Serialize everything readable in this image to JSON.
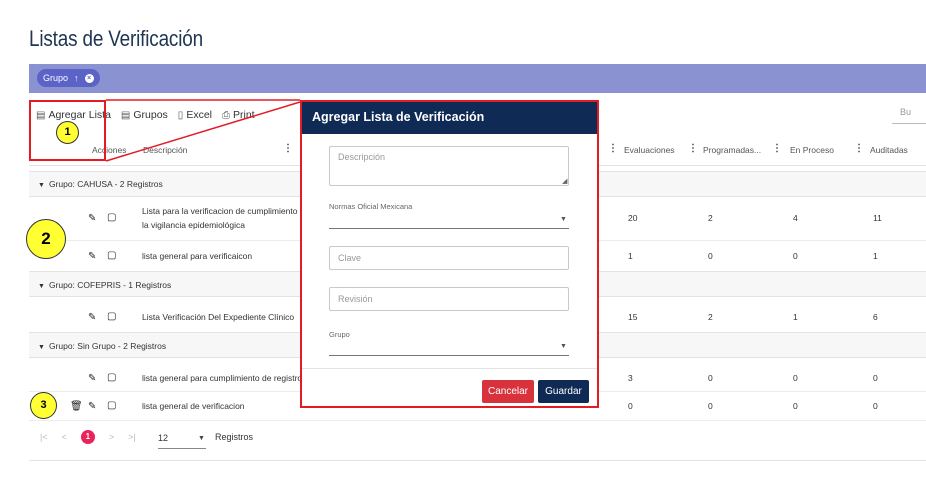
{
  "page": {
    "title": "Listas de Verificación"
  },
  "group_bar": {
    "chip_label": "Grupo",
    "chip_sort": "↑"
  },
  "toolbar": {
    "add_list": "Agregar Lista",
    "groups": "Grupos",
    "excel": "Excel",
    "print": "Print",
    "search_hint": "Bu"
  },
  "columns": {
    "acciones": "Acciones",
    "descripcion": "Descripción",
    "evaluaciones": "Evaluaciones",
    "programadas": "Programadas...",
    "en_proceso": "En Proceso",
    "auditadas": "Auditadas"
  },
  "groups": [
    {
      "label": "Grupo: CAHUSA - 2 Registros",
      "rows": [
        {
          "desc_line1": "Lista para la verificacion de cumplimiento de",
          "desc_line2": "la vigilancia epidemiológica",
          "evaluaciones": "20",
          "programadas": "2",
          "en_proceso": "4",
          "auditadas": "11"
        },
        {
          "desc_line1": "lista general para verificaicon",
          "evaluaciones": "1",
          "programadas": "0",
          "en_proceso": "0",
          "auditadas": "1"
        }
      ]
    },
    {
      "label": "Grupo: COFEPRIS - 1 Registros",
      "rows": [
        {
          "desc_line1": "Lista Verificación Del Expediente Clínico",
          "evaluaciones": "15",
          "programadas": "2",
          "en_proceso": "1",
          "auditadas": "6"
        }
      ]
    },
    {
      "label": "Grupo: Sin Grupo - 2 Registros",
      "rows": [
        {
          "desc_line1": "lista general para cumplimiento de registros",
          "evaluaciones": "3",
          "programadas": "0",
          "en_proceso": "0",
          "auditadas": "0"
        },
        {
          "desc_line1": "lista general de verificacion",
          "evaluaciones": "0",
          "programadas": "0",
          "en_proceso": "0",
          "auditadas": "0"
        }
      ]
    }
  ],
  "pager": {
    "current_page": "1",
    "page_size": "12",
    "label": "Registros"
  },
  "modal": {
    "title": "Agregar Lista de Verificación",
    "descripcion_placeholder": "Descripción",
    "normas_label": "Normas Oficial Mexicana",
    "clave_placeholder": "Clave",
    "revision_placeholder": "Revisión",
    "grupo_label": "Grupo",
    "cancel_label": "Cancelar",
    "save_label": "Guardar"
  },
  "callouts": {
    "one": "1",
    "two": "2",
    "three": "3"
  },
  "icons": {
    "edit": "pencil-icon",
    "copy": "copy-icon",
    "delete": "trash-icon"
  },
  "colors": {
    "group_bar": "#8b92d2",
    "chip": "#5b63c7",
    "modal_header": "#0e2a55",
    "cancel": "#d8333d",
    "highlight": "#e31b23",
    "callout": "#ffff33",
    "pager_active": "#e8245a"
  }
}
